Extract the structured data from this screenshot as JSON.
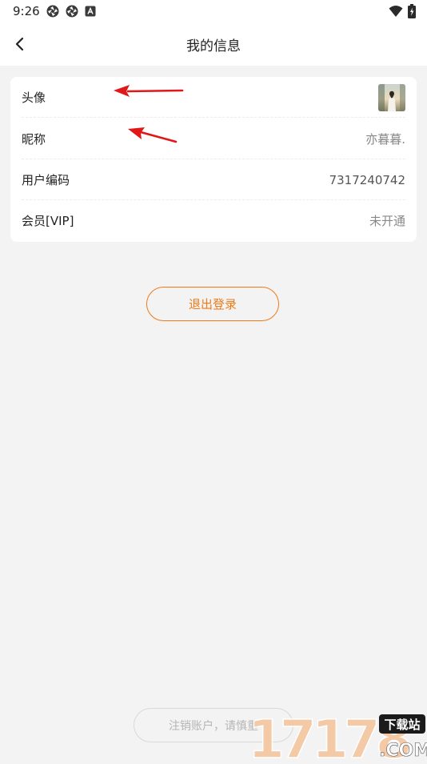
{
  "status_bar": {
    "time": "9:26",
    "left_icons": [
      "aperture-icon",
      "aperture-icon",
      "app-notification-icon"
    ],
    "right_icons": [
      "wifi-icon",
      "battery-icon"
    ]
  },
  "nav": {
    "title": "我的信息",
    "back_icon": "chevron-left-icon"
  },
  "profile": {
    "rows": [
      {
        "label": "头像",
        "value": ""
      },
      {
        "label": "昵称",
        "value": "亦暮暮."
      },
      {
        "label": "用户编码",
        "value": "7317240742"
      },
      {
        "label": "会员[VIP]",
        "value": "未开通"
      }
    ]
  },
  "actions": {
    "logout_label": "退出登录",
    "cancel_account_label": "注销账户，请慎重"
  },
  "watermark": {
    "main": "17178",
    "badge": "下载站",
    "suffix": ".COM"
  },
  "colors": {
    "accent": "#f07a18",
    "annotation_arrow": "#e01818",
    "background": "#f3f3f3"
  }
}
